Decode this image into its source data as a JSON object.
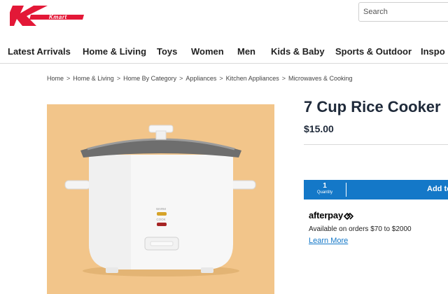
{
  "header": {
    "brand": "Kmart",
    "search_placeholder": "Search"
  },
  "nav": {
    "items": [
      "Latest Arrivals",
      "Home & Living",
      "Toys",
      "Women",
      "Men",
      "Kids & Baby",
      "Sports & Outdoor",
      "Inspo"
    ]
  },
  "breadcrumb": {
    "items": [
      "Home",
      "Home & Living",
      "Home By Category",
      "Appliances",
      "Kitchen Appliances",
      "Microwaves & Cooking"
    ],
    "separator": ">"
  },
  "product": {
    "title": "7 Cup Rice Cooker",
    "price": "$15.00",
    "image_labels": {
      "warm": "WARM",
      "cook": "COOK"
    },
    "image_background": "#f2c58a"
  },
  "cart": {
    "quantity": "1",
    "quantity_label": "Quantity",
    "add_label": "Add to Cart",
    "color": "#1478c8"
  },
  "afterpay": {
    "logo_text": "afterpay",
    "description": "Available on orders $70 to $2000",
    "learn_more": "Learn More"
  },
  "colors": {
    "brand_red": "#e31837",
    "link_blue": "#1478c8",
    "text_dark": "#1f2a3a"
  }
}
